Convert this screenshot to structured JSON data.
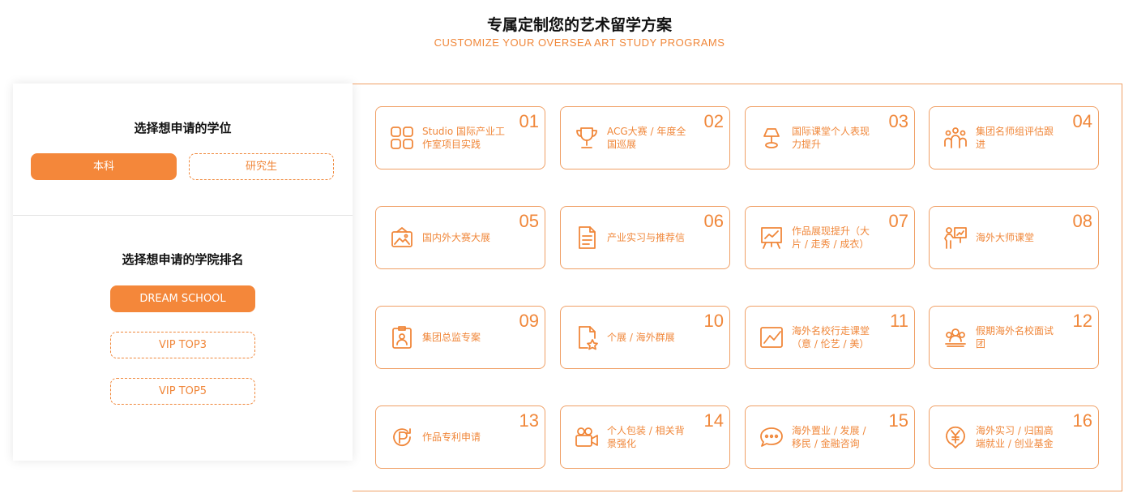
{
  "header": {
    "title": "专属定制您的艺术留学方案",
    "subtitle": "CUSTOMIZE YOUR OVERSEA ART STUDY PROGRAMS"
  },
  "degree": {
    "title": "选择想申请的学位",
    "options": [
      "本科",
      "研究生"
    ],
    "selected": "本科"
  },
  "ranking": {
    "title": "选择想申请的学院排名",
    "options": [
      "DREAM SCHOOL",
      "VIP TOP3",
      "VIP TOP5"
    ],
    "selected": "DREAM SCHOOL"
  },
  "services": [
    {
      "num": "01",
      "label": "Studio 国际产业工作室项目实践",
      "icon": "grid-icon"
    },
    {
      "num": "02",
      "label": "ACG大赛 / 年度全国巡展",
      "icon": "trophy-icon"
    },
    {
      "num": "03",
      "label": "国际课堂个人表现力提升",
      "icon": "lamp-icon"
    },
    {
      "num": "04",
      "label": "集团名师组评估跟进",
      "icon": "team-icon"
    },
    {
      "num": "05",
      "label": "国内外大赛大展",
      "icon": "exhibition-icon"
    },
    {
      "num": "06",
      "label": "产业实习与推荐信",
      "icon": "document-icon"
    },
    {
      "num": "07",
      "label": "作品展现提升（大片 / 走秀 / 成衣）",
      "icon": "chart-board-icon"
    },
    {
      "num": "08",
      "label": "海外大师课堂",
      "icon": "teacher-icon"
    },
    {
      "num": "09",
      "label": "集团总监专案",
      "icon": "badge-icon"
    },
    {
      "num": "10",
      "label": "个展 / 海外群展",
      "icon": "file-star-icon"
    },
    {
      "num": "11",
      "label": "海外名校行走课堂（意 / 伦艺 / 美）",
      "icon": "line-chart-icon"
    },
    {
      "num": "12",
      "label": "假期海外名校面试团",
      "icon": "group-icon"
    },
    {
      "num": "13",
      "label": "作品专利申请",
      "icon": "patent-icon"
    },
    {
      "num": "14",
      "label": "个人包装 / 相关背景强化",
      "icon": "camera-icon"
    },
    {
      "num": "15",
      "label": "海外置业 / 发展 / 移民 / 金融咨询",
      "icon": "chat-icon"
    },
    {
      "num": "16",
      "label": "海外实习 / 归国高端就业 / 创业基金",
      "icon": "yen-icon"
    }
  ],
  "colors": {
    "accent": "#f0873a",
    "border": "#f0a066"
  }
}
